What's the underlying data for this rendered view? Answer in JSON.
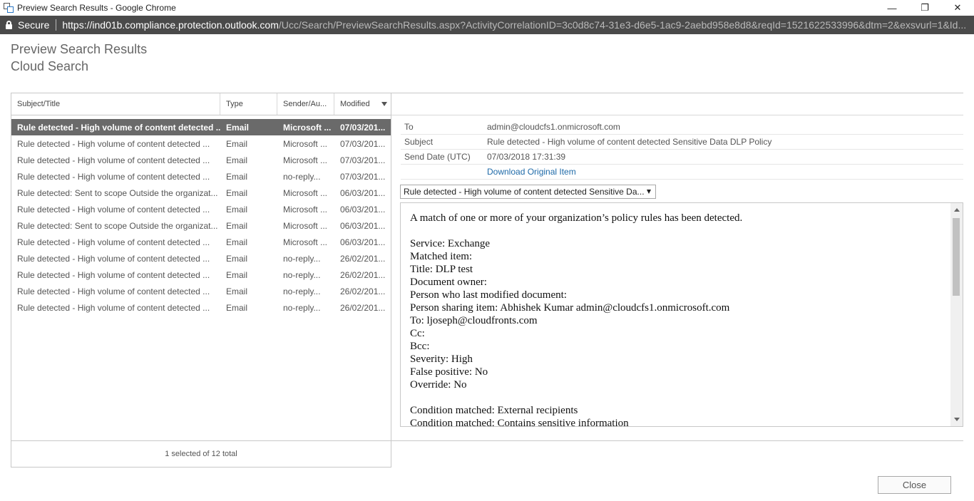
{
  "window": {
    "title": "Preview Search Results - Google Chrome",
    "minimize_glyph": "—",
    "restore_glyph": "❐",
    "close_glyph": "✕"
  },
  "address": {
    "secure_label": "Secure",
    "url_host": "https://ind01b.compliance.protection.outlook.com",
    "url_rest": "/Ucc/Search/PreviewSearchResults.aspx?ActivityCorrelationID=3c0d8c74-31e3-d6e5-1ac9-2aebd958e8d8&reqId=1521622533996&dtm=2&exsvurl=1&Id..."
  },
  "header": {
    "title": "Preview Search Results",
    "subtitle": "Cloud Search"
  },
  "results": {
    "columns": [
      "Subject/Title",
      "Type",
      "Sender/Au...",
      "Modified"
    ],
    "rows": [
      {
        "subject": "Rule detected - High volume of content detected ...",
        "type": "Email",
        "sender": "Microsoft ...",
        "modified": "07/03/201...",
        "selected": true
      },
      {
        "subject": "Rule detected - High volume of content detected ...",
        "type": "Email",
        "sender": "Microsoft ...",
        "modified": "07/03/201..."
      },
      {
        "subject": "Rule detected - High volume of content detected ...",
        "type": "Email",
        "sender": "Microsoft ...",
        "modified": "07/03/201..."
      },
      {
        "subject": "Rule detected - High volume of content detected ...",
        "type": "Email",
        "sender": "no-reply...",
        "modified": "07/03/201..."
      },
      {
        "subject": "Rule detected: Sent to scope Outside the organizat...",
        "type": "Email",
        "sender": "Microsoft ...",
        "modified": "06/03/201..."
      },
      {
        "subject": "Rule detected - High volume of content detected ...",
        "type": "Email",
        "sender": "Microsoft ...",
        "modified": "06/03/201..."
      },
      {
        "subject": "Rule detected: Sent to scope Outside the organizat...",
        "type": "Email",
        "sender": "Microsoft ...",
        "modified": "06/03/201..."
      },
      {
        "subject": "Rule detected - High volume of content detected ...",
        "type": "Email",
        "sender": "Microsoft ...",
        "modified": "06/03/201..."
      },
      {
        "subject": "Rule detected - High volume of content detected ...",
        "type": "Email",
        "sender": "no-reply...",
        "modified": "26/02/201..."
      },
      {
        "subject": "Rule detected - High volume of content detected ...",
        "type": "Email",
        "sender": "no-reply...",
        "modified": "26/02/201..."
      },
      {
        "subject": "Rule detected - High volume of content detected ...",
        "type": "Email",
        "sender": "no-reply...",
        "modified": "26/02/201..."
      },
      {
        "subject": "Rule detected - High volume of content detected ...",
        "type": "Email",
        "sender": "no-reply...",
        "modified": "26/02/201..."
      }
    ],
    "footer": "1 selected of 12 total"
  },
  "preview": {
    "meta": [
      {
        "label": "To",
        "value": "admin@cloudcfs1.onmicrosoft.com"
      },
      {
        "label": "Subject",
        "value": "Rule detected - High volume of content detected Sensitive Data DLP Policy"
      },
      {
        "label": "Send Date (UTC)",
        "value": "07/03/2018 17:31:39"
      },
      {
        "label": "",
        "value": "Download Original Item",
        "link": true
      }
    ],
    "item_select": "Rule detected - High volume of content detected Sensitive Da...",
    "body_lines": [
      "A match of one or more of your organization’s policy rules has been detected.",
      "",
      "Service: Exchange",
      "Matched item:",
      "Title: DLP test",
      "Document owner:",
      "Person who last modified document:",
      "Person sharing item: Abhishek Kumar admin@cloudcfs1.onmicrosoft.com",
      "To: ljoseph@cloudfronts.com",
      "Cc:",
      "Bcc:",
      "Severity: High",
      "False positive: No",
      "Override: No",
      "",
      "Condition matched: External recipients",
      "Condition matched: Contains sensitive information"
    ]
  },
  "actions": {
    "close_label": "Close"
  },
  "colors": {
    "address_bar_bg": "#4a4a4a",
    "selected_row_bg": "#6a6a6a",
    "link": "#1e6aa8"
  }
}
